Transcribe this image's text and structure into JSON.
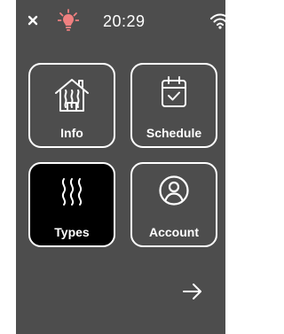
{
  "status": {
    "time": "20:29",
    "icons": [
      "close-icon",
      "bulb-icon",
      "wifi-icon"
    ]
  },
  "tiles": [
    {
      "label": "Info",
      "icon": "house-heat-icon",
      "selected": false
    },
    {
      "label": "Schedule",
      "icon": "calendar-check-icon",
      "selected": false
    },
    {
      "label": "Types",
      "icon": "heat-waves-icon",
      "selected": true
    },
    {
      "label": "Account",
      "icon": "user-icon",
      "selected": false
    }
  ],
  "nav": {
    "next_icon": "arrow-right-icon"
  },
  "colors": {
    "background": "#4d4d4d",
    "selected_tile": "#000000",
    "foreground": "#ffffff",
    "alert": "#f08080"
  }
}
